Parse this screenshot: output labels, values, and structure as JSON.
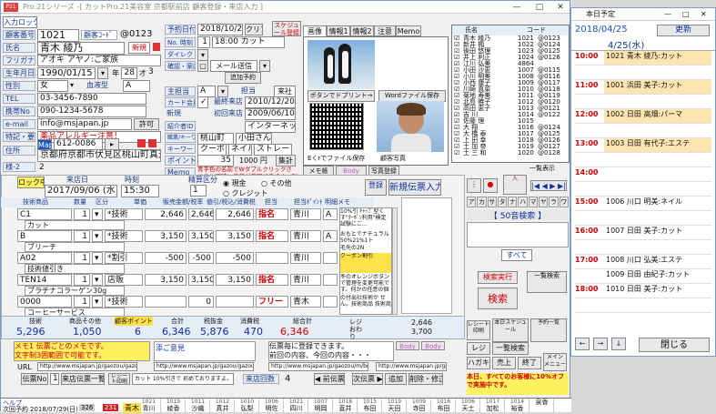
{
  "window": {
    "title": "Pro.21シリーズ  -[ カットPro.21美容室  京都駅前店  顧客登録・来店入力 ]",
    "app_icon": "P21"
  },
  "header": {
    "finder_btn": "入力ロック",
    "cust_no_label": "顧客番号",
    "cust_no": "1021",
    "cust_code_label": "顧客ｺｰﾄﾞ",
    "cust_code": "@0123"
  },
  "customer": {
    "name_label": "氏名",
    "name": "青木 綾乃",
    "kana_label": "フリガナ",
    "kana": "アオキ アヤノ:ご家族",
    "birth_label": "生年月日",
    "birth": "1990/01/15",
    "age_label": "年",
    "age": "28",
    "month": "3",
    "sex_label": "性別",
    "sex": "女",
    "blood_label": "血液型",
    "blood": "A",
    "tel_label": "TEL",
    "tel": "03-3456-7890",
    "mobile_label": "携帯No",
    "mobile": "090-1234-5678",
    "email_label": "e-mail",
    "email": "info@msjapan.jp",
    "email_perm": "許可",
    "memo_label": "特記・要事",
    "memo": "薬品アレルギー注意！",
    "zip_btn": "Map",
    "zip": "612-0086",
    "addr_label": "住所",
    "addr": "京都府京都市伏見区桃山町真斉",
    "info_btn": "様-2",
    "info_value": "2",
    "new_badge": "新規"
  },
  "reservation": {
    "date_label": "予約日付",
    "date": "2018/10/20",
    "clear": "クリア",
    "sched_btn": "スケジュール登録",
    "no_label": "No. 時刻",
    "no_value": "1",
    "time": "18:00 カット",
    "dm_label": "ダイレクトメール",
    "dm_btn": "ＤＭ",
    "mail_label": "確認・案内",
    "mail_value": "メール送信",
    "mail_send": "",
    "regist_btn": "追加予約",
    "staff_label": "主担当",
    "staff_value": "A",
    "count_label": "担当",
    "count_value": "",
    "approve": "来社",
    "card_label": "カード会員",
    "card_value": "✓",
    "last_label": "最終来店",
    "last": "2010/12/20",
    "new_label": "新規",
    "first_label": "初回来店",
    "first": "2009/06/10",
    "intro_label": "紹介者ID",
    "intro_value": "",
    "keyword_label": "職業/キーワード",
    "keyword_value": "インターネット",
    "keyword2_label": "キーワード",
    "keyword2_a": "桃山町",
    "keyword2_b": "小田さん",
    "coupon_a": "クーポン",
    "coupon_b": "ネイル",
    "coupon_c": "ストレート",
    "point_label": "ポイント",
    "point": "35",
    "point_unit": "1000 円",
    "point_btn": "集計",
    "memo_label": "Memo",
    "notice": "青字色の名前でWダブルクリックさせると同時に情報が参照できます。別表示、氏名をダブルクリックすると\"氏名\"で並び一覧検索になります。"
  },
  "tabs": [
    "画像",
    "情報1",
    "情報2",
    "注意",
    "Memo"
  ],
  "images": {
    "drop1": "ボタンでドプリント→",
    "drop2": "Wordファイル保存",
    "qr": "QRコード",
    "save_tag": "Eくrでファイル保存",
    "photo_label": "顧客写真",
    "memo2": "メモ帳",
    "photo_memo": "写真登録"
  },
  "customer_list": {
    "headers": [
      "氏名",
      "コード"
    ],
    "rows": [
      [
        "青木 綾乃",
        "1021",
        "@0123"
      ],
      [
        "新井 楓",
        "1022",
        "@0124"
      ],
      [
        "後田 悠理",
        "1023",
        "@0125"
      ],
      [
        "井上 利正",
        "1024",
        "@0126"
      ],
      [
        "江川 弘美",
        "4864",
        ""
      ],
      [
        "小田 沙恵",
        "1007",
        "@0115"
      ],
      [
        "小川 明美",
        "1008",
        "@0116"
      ],
      [
        "小西 康子",
        "1009",
        "@0117"
      ],
      [
        "川崎 真菜",
        "1010",
        "@0118"
      ],
      [
        "菊地 寿美",
        "1011",
        "@0119"
      ],
      [
        "北島 暁子",
        "1012",
        "@0120"
      ],
      [
        "高田 恵子",
        "1013",
        "@0121"
      ],
      [
        "吉 川",
        "1014",
        "@0122"
      ],
      [
        "佐藤 理",
        "1015",
        ""
      ],
      [
        "大 翔",
        "1016",
        "@0124"
      ],
      [
        "大 橋 泰",
        "1017",
        "@0125"
      ],
      [
        "上 田 幸",
        "1018",
        "@0126"
      ],
      [
        "土 加 帝",
        "1019",
        "@0127"
      ],
      [
        "土 三 和",
        "1020",
        "@0128"
      ]
    ],
    "all_btn": "一覧表示"
  },
  "visit": {
    "lock": "ロック中",
    "visit_label": "来店日",
    "visit_date": "2017/09/06 (水)",
    "time_label": "時刻",
    "time": "15:30",
    "settle_label": "精算区分",
    "settle": "1",
    "cash": "現金",
    "other": "その他",
    "credit": "クレジット",
    "register_btn": "登録",
    "new_btn": "新規伝票入力",
    "col_item": "技術商品",
    "col_qty": "数量",
    "col_kind": "区分",
    "col_unit": "単価",
    "col_price": "販売金額/税率",
    "col_sum": "値引/税込/消費税",
    "col_staff": "担当",
    "col_pt": "担当ﾎﾟｲﾝﾄ",
    "col_memo": "明細メモ",
    "rows": [
      {
        "code": "C1",
        "name": "カット",
        "qty": "1",
        "kind": "*技術",
        "unit": "2,646",
        "price": "8",
        "disc": "2,646",
        "tax": "2,646",
        "staff": "指名",
        "staff_name": "青川",
        "pt": "A"
      },
      {
        "code": "B",
        "name": "ブリーチ",
        "qty": "1",
        "kind": "*技術",
        "unit": "3,150",
        "price": "8",
        "disc": "3,150",
        "tax": "3,150",
        "staff": "指名",
        "staff_name": "青川",
        "pt": "A"
      },
      {
        "code": "A02",
        "name": "技術値引き",
        "qty": "1",
        "kind": "*割引",
        "unit": "-500",
        "price": "8",
        "disc": "-500",
        "tax": "-500",
        "staff": "",
        "staff_name": "青川",
        "pt": ""
      },
      {
        "code": "TEN14",
        "name": "プラチナコラーゲン30g",
        "qty": "1",
        "kind": "店販",
        "unit": "3,150",
        "price": "8",
        "disc": "3,150",
        "tax": "3,150",
        "staff": "指名",
        "staff_name": "青川",
        "pt": ""
      },
      {
        "code": "0000",
        "name": "コーヒーサービス",
        "qty": "1",
        "kind": "*技術",
        "unit": "",
        "price": "8",
        "disc": "0",
        "tax": "",
        "staff": "フリー",
        "staff_name": "青木",
        "pt": ""
      }
    ],
    "memos": [
      "10%引 ｷｬｯﾌﾟ型くす\"ｸｰﾎﾟﾝ利用\"検定試験にご…",
      "おもとでナチュラル 50%21%1ト",
      "毛先の2N",
      "クーポン割引",
      "冬のオレンジボタン\nで管理を変更可能です、何かの任意の個人",
      "の付出社技術が\nせん。技術商品 技術商品",
      "ニ スタッフ変更 ラ"
    ],
    "totals": {
      "tech_label": "技術",
      "tech": "5,296",
      "goods_label": "商品その他",
      "goods": "1,050",
      "pt_label": "顧客ポイント",
      "pt": "6",
      "sub_label": "合計",
      "sub": "6,346",
      "tax_label": "税抜金",
      "tax": "5,876",
      "tax2_label": "消費税",
      "tax2": "470",
      "total_label": "総合計",
      "total": "6,346",
      "reg_label": "レジおわり",
      "r1": "2,646",
      "r2": "3,700"
    },
    "memo_box": "メモ1 伝票ごとのメモです。\n文字制3囲範囲で可能です。",
    "memo_box_right": "添ご意見",
    "notice2": "伝票毎に登録できます。\n前回の内容、今回の内容・・・",
    "url_label": "URL",
    "url1": "http://www.msjapan.jp/gaozou/gazou01.jpg",
    "url2": "http://www.msjapan.jp/gazou/gazou02.jpg",
    "url3": "http://www.msjapan.jp/gaozou/m/bolurhori.xls",
    "url4": "http://www.msjapan.jp/gazou/gazou03.jpg",
    "slip_btn": "伝票No",
    "slip": "1",
    "visit_list": "来店伝票一覧",
    "receipt": "レシート印刷",
    "cut_note": "カット 10%引きで 初めておりますよ。",
    "count_label": "来店回数",
    "count": "4",
    "prev_label": "前伝票",
    "next_label": "次伝票",
    "add_label": "追加",
    "del_label": "削除・修正",
    "close_label": "全"
  },
  "right_controls": {
    "kana_tabs": [
      "ア",
      "カ",
      "サ",
      "タ",
      "ナ",
      "ハ",
      "マ",
      "ヤ",
      "ラ",
      "ワ"
    ],
    "kana_search": "【 50音検索 】",
    "all": "すべて",
    "search_btn": "検索",
    "search_btn2": "検索実行",
    "clear_btn": "一覧検索",
    "receipt": "レシート印刷",
    "schedule": "本日スケジュール",
    "all_list": "一覧検索",
    "pos": "予約一覧",
    "cashbox": "レジ",
    "hagaki": "ハガキ",
    "shop": "売上",
    "exit": "終了",
    "menu": "メイン\nメニュー",
    "notice": "本日、すべてのお客様に10%オフで実施中です。"
  },
  "bottom": {
    "help": "ヘルプ",
    "next_label": "次回予約",
    "next_date": "2018/07/29(日)",
    "no": "326",
    "count": "231",
    "shortcut": "青木",
    "names": [
      "青川",
      "綾香",
      "沙織",
      "真井",
      "弘梨",
      "明佐",
      "四川",
      "明岡",
      "直井",
      "布田",
      "天田",
      "寺田",
      "布田",
      "天土",
      "加松",
      "裕香",
      "泉香"
    ],
    "codes": [
      "1021",
      "1019",
      "1011",
      "1012",
      "1010",
      "1006",
      "1021",
      "1007",
      "1018",
      "1015",
      "1019",
      "1009",
      "1016",
      "1006",
      "1017",
      "1014"
    ]
  },
  "schedule": {
    "title": "本日予定",
    "date": "2018/04/25",
    "refresh": "更新",
    "weekday": "4/25(水)",
    "rows": [
      {
        "time": "10:00",
        "text": "1021 青木 綾乃:カット",
        "color": "#ffe6b0"
      },
      {
        "time": "",
        "text": "",
        "color": ""
      },
      {
        "time": "11:00",
        "text": "1001 浜田 美子:カット",
        "color": "#ffe6b0"
      },
      {
        "time": "",
        "text": "",
        "color": ""
      },
      {
        "time": "12:00",
        "text": "1002 日田 高畑:パーマ",
        "color": "#ffe6b0"
      },
      {
        "time": "",
        "text": "",
        "color": ""
      },
      {
        "time": "13:00",
        "text": "1003 日田 有代子:エステ",
        "color": "#ffe6b0"
      },
      {
        "time": "",
        "text": "",
        "color": ""
      },
      {
        "time": "14:00",
        "text": "",
        "color": ""
      },
      {
        "time": "",
        "text": "",
        "color": ""
      },
      {
        "time": "15:00",
        "text": "1006 川口 明美:ネイル",
        "color": ""
      },
      {
        "time": "",
        "text": "",
        "color": ""
      },
      {
        "time": "16:00",
        "text": "1007 日田 美子:カット",
        "color": ""
      },
      {
        "time": "",
        "text": "",
        "color": ""
      },
      {
        "time": "17:00",
        "text": "1008 川口 弘美:エステ",
        "color": ""
      },
      {
        "time": "",
        "text": "1009 日田 由紀子:カット",
        "color": ""
      },
      {
        "time": "18:00",
        "text": "1010 日田 美子:カット",
        "color": ""
      },
      {
        "time": "",
        "text": "",
        "color": ""
      }
    ],
    "close": "閉じる",
    "prev": "←",
    "next": "→",
    "down": "↓"
  }
}
